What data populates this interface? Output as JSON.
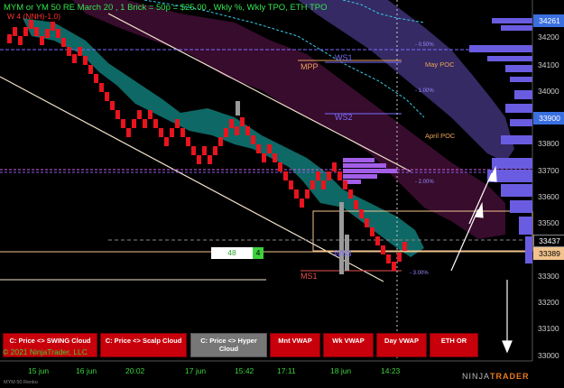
{
  "chart": {
    "title": "MYM or YM 50 RE March 20 , 1 Brick = 50p = $25.00 , Wkly %, Wkly TPO, ETH TPO",
    "subtitle": "W 4 (NNH)-1.0)",
    "copyright": "© 2021 NinjaTrader, LLC",
    "footer": "MYM 50 Renko",
    "logo_prefix": "NINJA",
    "logo_suffix": "TRADER",
    "price_axis": [
      "34200",
      "34100",
      "34000",
      "33800",
      "33700",
      "33600",
      "33500",
      "33300",
      "33200",
      "33100",
      "33000"
    ],
    "badge_top": "34261",
    "badge_mid": "33900",
    "badge_last": "33437",
    "badge_current": "33389",
    "badge_top_color": "#3a6fe0",
    "badge_mid_color": "#3a6fe0",
    "badge_current_color": "#f2c38e",
    "x_labels": [
      "15 jun",
      "16 jun",
      "20:02",
      "17 jun",
      "15:42",
      "17:11",
      "18 jun",
      "14:23"
    ],
    "level_labels": {
      "mpp": "MPP",
      "ws1": "WS1",
      "ws2": "WS2",
      "ws3": "WS3",
      "ms1": "MS1",
      "may_poc": "May POC",
      "april_poc": "April POC",
      "p050": "- 0.50%",
      "p100": "- 1.00%",
      "p200": "- 2.00%",
      "p300": "- 3.00%"
    },
    "box_green": "48",
    "box_count": "4",
    "buttons": [
      {
        "label": "C: Price <> SWING Cloud"
      },
      {
        "label": "C: Price <> Scalp Cloud"
      },
      {
        "label": "C: Price <> Hyper Cloud"
      },
      {
        "label": "Mnt VWAP"
      },
      {
        "label": "Wk VWAP"
      },
      {
        "label": "Day VWAP"
      },
      {
        "label": "ETH OR"
      }
    ]
  }
}
